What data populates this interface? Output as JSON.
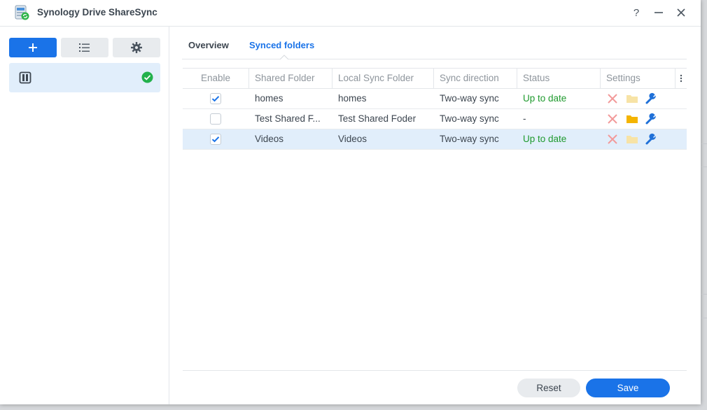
{
  "window": {
    "title": "Synology Drive ShareSync",
    "help_label": "?",
    "minimize_label": "—",
    "close_label": "✕"
  },
  "sidebar": {
    "add_icon": "plus-icon",
    "list_icon": "list-icon",
    "settings_icon": "gear-icon",
    "items": [
      {
        "icon": "nas-server-icon",
        "status_icon": "check-circle-icon",
        "status_color": "#22b14c"
      }
    ]
  },
  "tabs": [
    {
      "label": "Overview",
      "active": false
    },
    {
      "label": "Synced folders",
      "active": true
    }
  ],
  "table": {
    "columns": [
      "Enable",
      "Shared Folder",
      "Local Sync Folder",
      "Sync direction",
      "Status",
      "Settings"
    ],
    "column_menu_icon": "vertical-dots-icon",
    "rows": [
      {
        "enabled": true,
        "shared_folder": "homes",
        "local_folder": "homes",
        "direction": "Two-way sync",
        "status": "Up to date",
        "status_kind": "ok",
        "selected": false,
        "folder_icon_faded": true
      },
      {
        "enabled": false,
        "shared_folder": "Test Shared F...",
        "local_folder": "Test Shared Foder",
        "direction": "Two-way sync",
        "status": "-",
        "status_kind": "none",
        "selected": false,
        "folder_icon_faded": false
      },
      {
        "enabled": true,
        "shared_folder": "Videos",
        "local_folder": "Videos",
        "direction": "Two-way sync",
        "status": "Up to date",
        "status_kind": "ok",
        "selected": true,
        "folder_icon_faded": true
      }
    ],
    "row_icons": [
      "remove-x-icon",
      "folder-icon",
      "wrench-icon"
    ]
  },
  "footer": {
    "reset_label": "Reset",
    "save_label": "Save"
  },
  "colors": {
    "accent": "#1a73e8",
    "status_ok": "#1f9a2e",
    "remove": "#f29a9a",
    "folder": "#f4b400",
    "folder_faded": "#f7e3a6",
    "wrench": "#1f70d8"
  }
}
